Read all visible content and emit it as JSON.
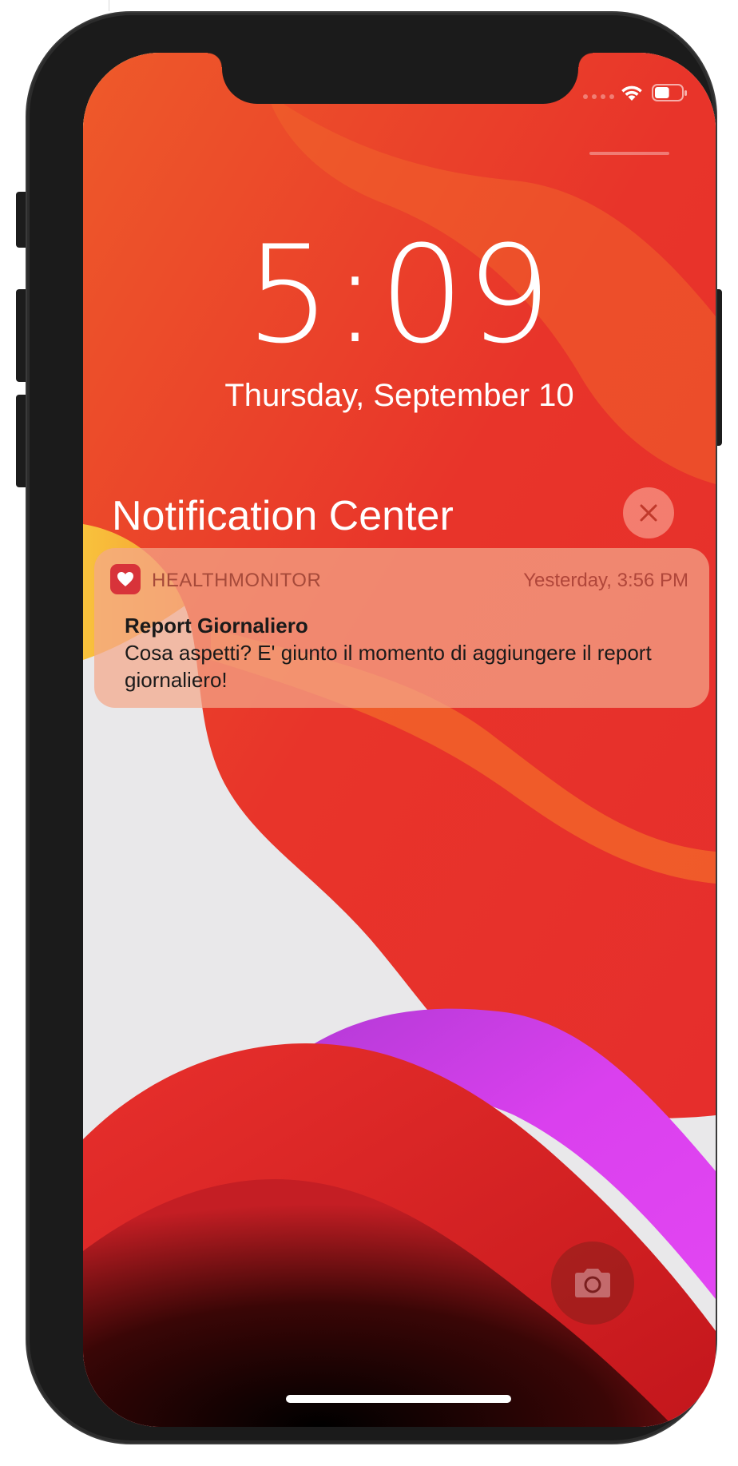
{
  "lock_screen": {
    "time": "5:09",
    "date": "Thursday, September 10"
  },
  "status_bar": {
    "icons": [
      "signal-dots-icon",
      "wifi-icon",
      "battery-icon"
    ],
    "battery_fraction": 0.55
  },
  "notification_center": {
    "title": "Notification Center",
    "close_icon": "close-icon"
  },
  "notification": {
    "app_name": "HEALTHMONITOR",
    "app_icon": "heart-icon",
    "time": "Yesterday, 3:56 PM",
    "title": "Report Giornaliero",
    "body": "Cosa aspetti? E' giunto il momento di aggiungere il report giornaliero!"
  },
  "quick_actions": {
    "camera_icon": "camera-icon"
  },
  "colors": {
    "wallpaper_red": "#e8302a",
    "wallpaper_orange": "#f05a24",
    "wallpaper_magenta": "#d63ce8",
    "notification_bg": "#f4a88a",
    "app_icon_bg": "#d8333a"
  }
}
